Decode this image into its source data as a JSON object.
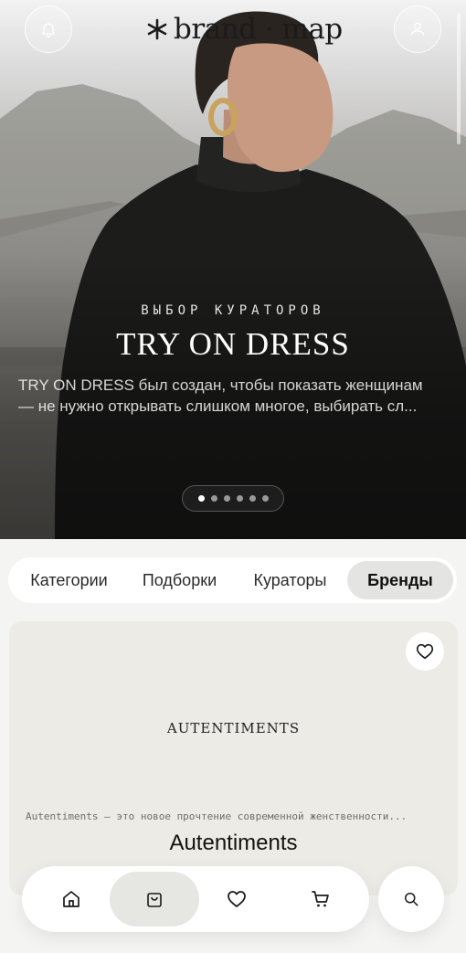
{
  "header": {
    "logo_text": "brand · map",
    "logo_icon": "asterisk-logo-icon",
    "notifications_icon": "bell-icon",
    "profile_icon": "user-icon"
  },
  "hero": {
    "eyebrow": "ВЫБОР КУРАТОРОВ",
    "title": "TRY ON DRESS",
    "description_line1": "TRY ON DRESS был создан, чтобы показать женщинам",
    "description_line2": "— не нужно открывать слишком многое, выбирать сл...",
    "slides_total": 6,
    "slide_active": 1
  },
  "tabs": {
    "items": [
      "Категории",
      "Подборки",
      "Кураторы",
      "Бренды"
    ],
    "active": "Бренды"
  },
  "brand_card": {
    "logo_text": "AUTENTIMENTS",
    "description": "Autentiments — это новое прочтение современной женственности...",
    "name": "Autentiments",
    "favorite_icon": "heart-outline-icon"
  },
  "bottom_nav": {
    "items": [
      "home-icon",
      "shopping-bag-icon",
      "heart-icon",
      "cart-icon"
    ],
    "active": "shopping-bag-icon",
    "search_icon": "search-icon"
  },
  "colors": {
    "page_bg": "#f4f4f2",
    "active_tab_bg": "#e4e4e2",
    "card_bg": "#ecebe6"
  }
}
